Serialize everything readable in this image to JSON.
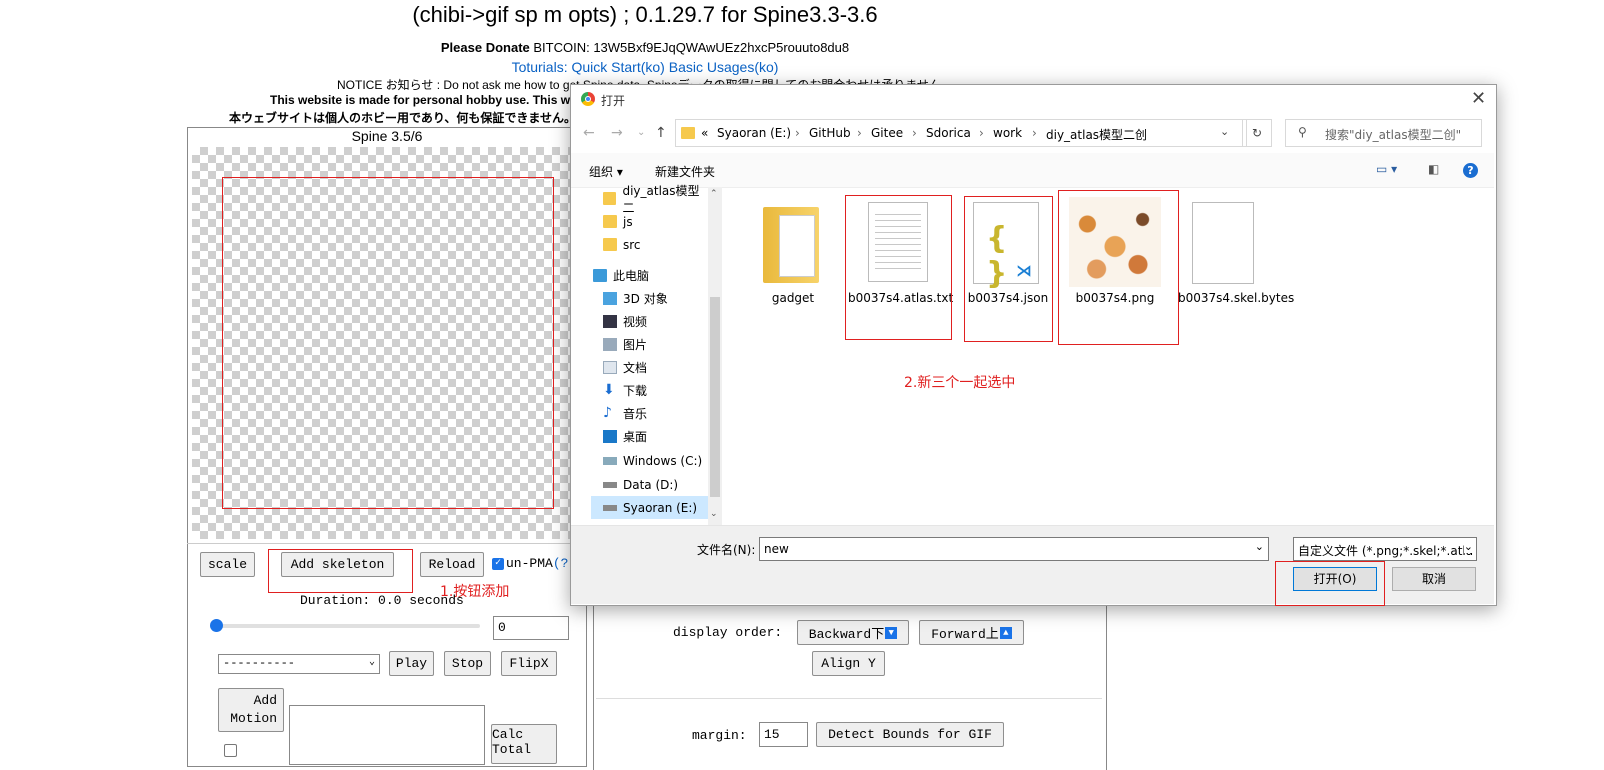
{
  "page": {
    "title": "(chibi->gif sp m opts) ; 0.1.29.7 for Spine3.3-3.6",
    "donate_label": "Please Donate",
    "donate_text": "BITCOIN: 13W5Bxf9EJqQWAwUEz2hxcP5rouuto8du8",
    "tutorials_label": "Toturials:",
    "tutorial_links": [
      "Quick Start(ko)",
      "Basic Usages(ko)"
    ],
    "notice": "NOTICE お知らせ : Do not ask me how to get Spine data. Spineデータの取得に関してのお問合わせは承りません。",
    "hobby_en": "This website is made for personal hobby use. This we",
    "hobby_jp": "本ウェブサイトは個人のホビー用であり、何も保証できません。"
  },
  "panel": {
    "title": "Spine 3.5/6",
    "scale_label": "scale",
    "add_skeleton_label": "Add skeleton",
    "reload_label": "Reload",
    "unpma_label": "un-PMA",
    "unpma_help": "(?",
    "duration_text": "Duration: 0.0 seconds",
    "frame_value": "0",
    "anim_select": "----------",
    "play_label": "Play",
    "stop_label": "Stop",
    "flipx_label": "FlipX",
    "add_motion_label": "Add Motion",
    "calc_label": "Calc Total",
    "display_order_label": "display order:",
    "backward_label": "Backward下",
    "forward_label": "Forward上",
    "align_y_label": "Align Y",
    "margin_label": "margin:",
    "margin_value": "15",
    "detect_bounds_label": "Detect Bounds for GIF"
  },
  "annotations": {
    "step1": "1.按钮添加",
    "step2": "2.新三个一起选中"
  },
  "dialog": {
    "title": "打开",
    "breadcrumb_prefix": "«",
    "breadcrumb": [
      "Syaoran (E:)",
      "GitHub",
      "Gitee",
      "Sdorica",
      "work",
      "diy_atlas模型二创"
    ],
    "search_placeholder": "搜索\"diy_atlas模型二创\"",
    "organize_label": "组织",
    "new_folder_label": "新建文件夹",
    "nav_items": [
      {
        "label": "diy_atlas模型二",
        "icon": "folder-icon"
      },
      {
        "label": "js",
        "icon": "folder-icon"
      },
      {
        "label": "src",
        "icon": "folder-icon"
      },
      {
        "label": "此电脑",
        "icon": "computer-icon"
      },
      {
        "label": "3D 对象",
        "icon": "cube-icon"
      },
      {
        "label": "视频",
        "icon": "video-icon"
      },
      {
        "label": "图片",
        "icon": "picture-icon"
      },
      {
        "label": "文档",
        "icon": "document-icon"
      },
      {
        "label": "下载",
        "icon": "download-icon"
      },
      {
        "label": "音乐",
        "icon": "music-icon"
      },
      {
        "label": "桌面",
        "icon": "desktop-icon"
      },
      {
        "label": "Windows (C:)",
        "icon": "drive-icon"
      },
      {
        "label": "Data (D:)",
        "icon": "drive-icon"
      },
      {
        "label": "Syaoran (E:)",
        "icon": "drive-icon"
      }
    ],
    "files": [
      {
        "name": "gadget",
        "icon": "folder-icon"
      },
      {
        "name": "b0037s4.atlas.txt",
        "icon": "text-file-icon"
      },
      {
        "name": "b0037s4.json",
        "icon": "json-file-icon"
      },
      {
        "name": "b0037s4.png",
        "icon": "image-file-icon"
      },
      {
        "name": "b0037s4.skel.bytes",
        "icon": "blank-file-icon"
      }
    ],
    "filename_label": "文件名(N):",
    "filename_value": "new",
    "filetype_value": "自定义文件 (*.png;*.skel;*.atla",
    "open_label": "打开(O)",
    "cancel_label": "取消"
  },
  "colors": {
    "annotation_red": "#e02020",
    "link_blue": "#0b62c4",
    "nav_selected": "#cce8ff"
  }
}
